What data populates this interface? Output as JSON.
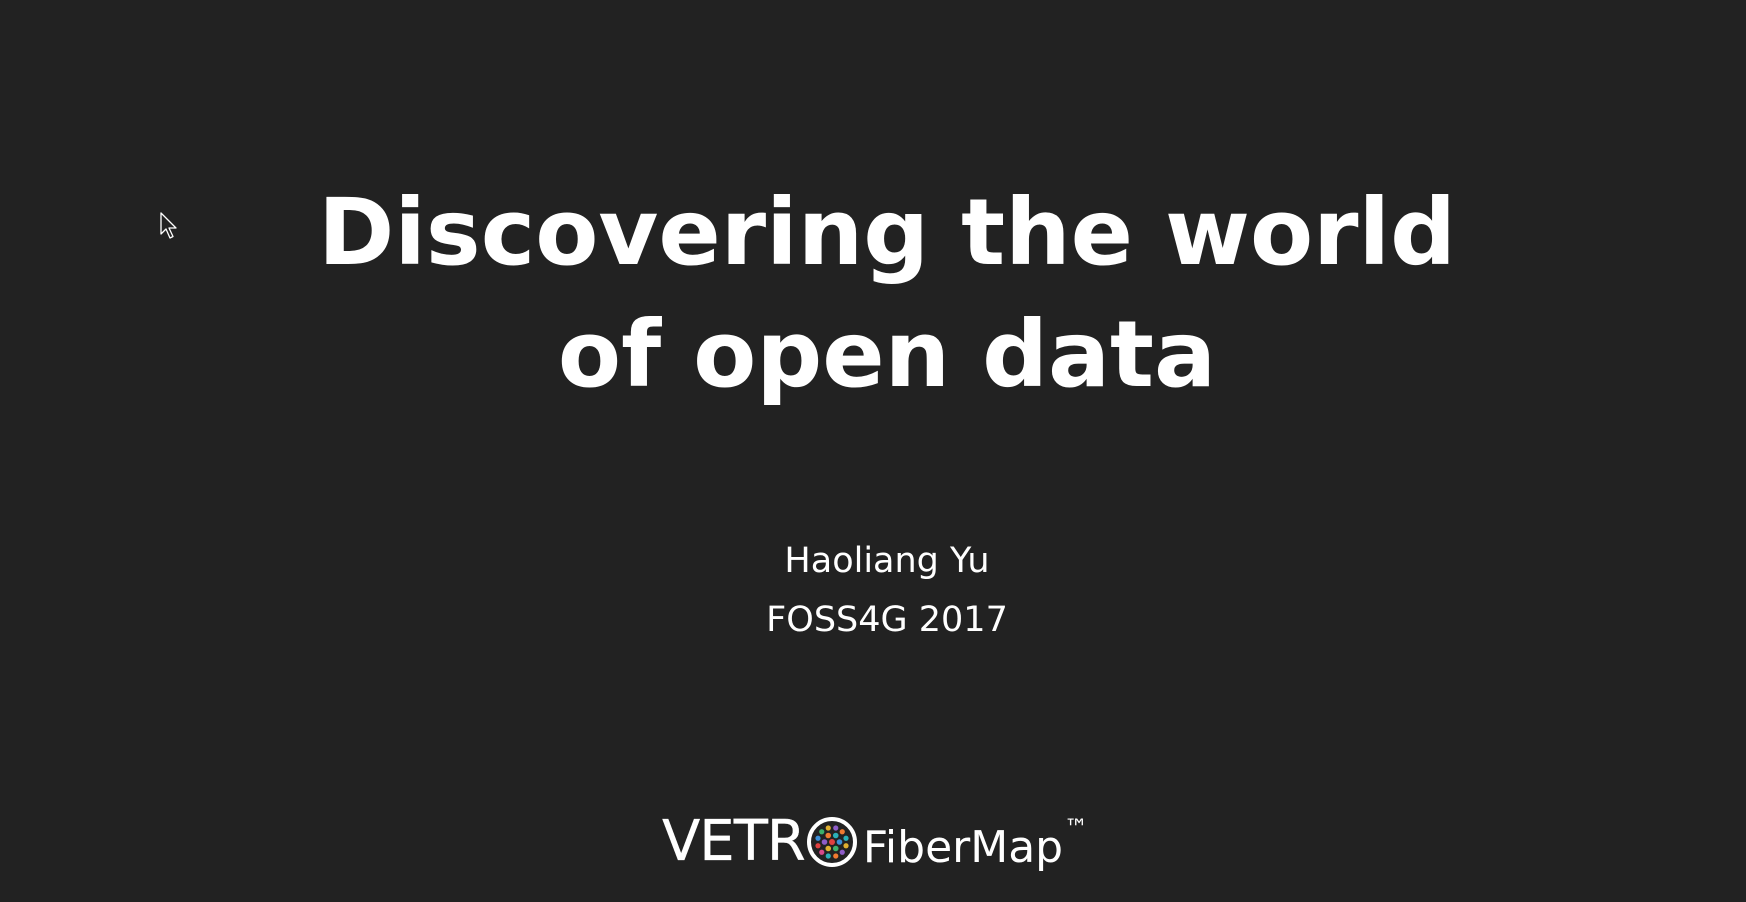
{
  "slide": {
    "title_lines": [
      "Discovering the world",
      "of open data"
    ],
    "author": "Haoliang Yu",
    "event": "FOSS4G 2017"
  },
  "logo": {
    "brand": "VETR",
    "product": "FiberMap",
    "trademark": "™",
    "icon": "fiber-bundle-icon",
    "dot_colors": [
      "#e04040",
      "#3a8fd8",
      "#3cb06a",
      "#e0b030",
      "#8e5cc8",
      "#f07a30",
      "#2ab0b8",
      "#d84a8a"
    ]
  },
  "cursor": {
    "icon": "mouse-pointer-icon"
  },
  "colors": {
    "background": "#222222",
    "text": "#ffffff"
  }
}
